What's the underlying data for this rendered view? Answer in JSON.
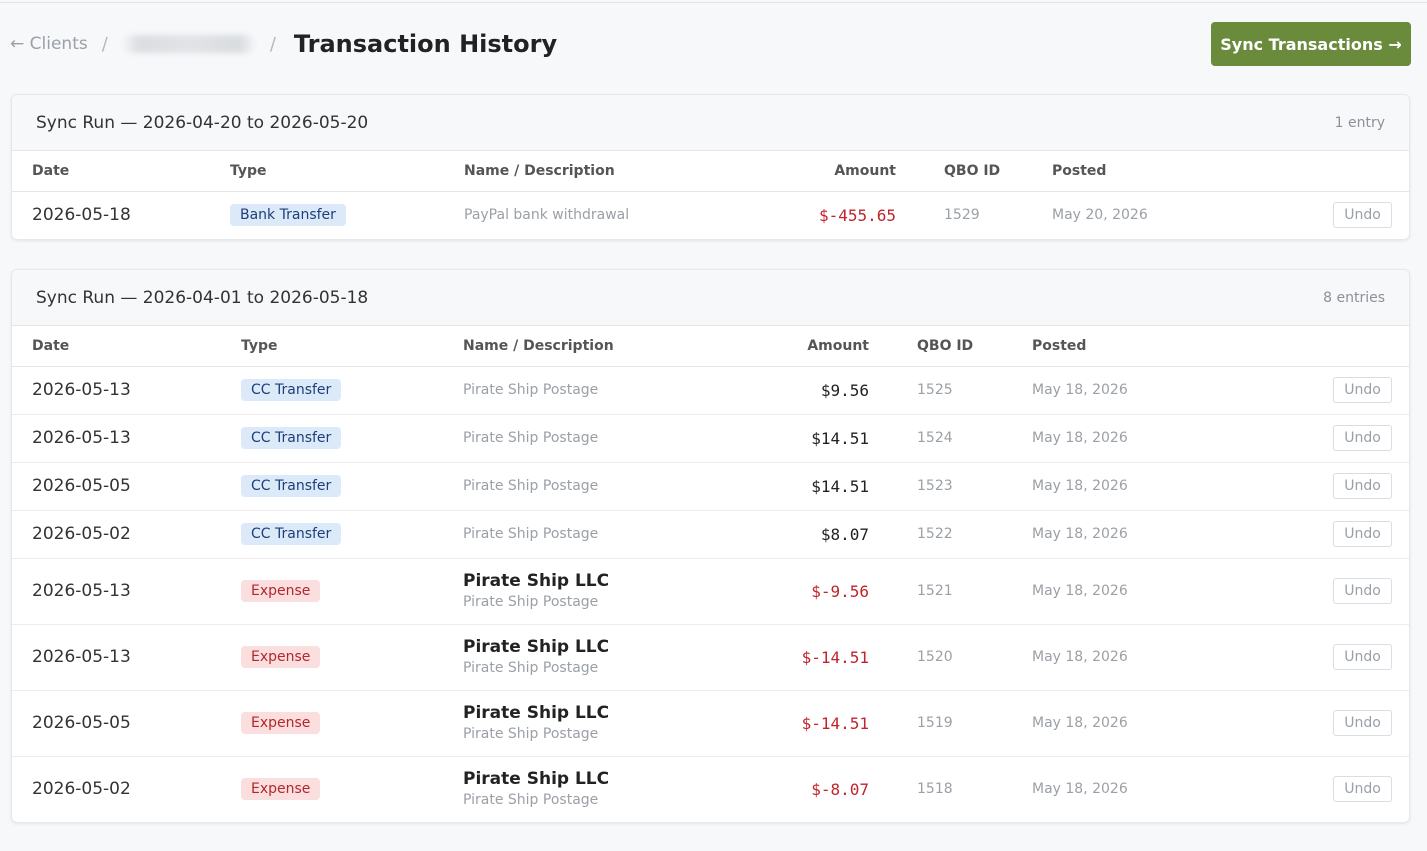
{
  "header": {
    "back_label": "← Clients",
    "separator": "/",
    "title": "Transaction History",
    "sync_button": "Sync Transactions →"
  },
  "columns": {
    "date": "Date",
    "type": "Type",
    "name": "Name / Description",
    "amount": "Amount",
    "qbo": "QBO ID",
    "posted": "Posted"
  },
  "undo_label": "Undo",
  "colors": {
    "accent": "#6a8a3c",
    "negative": "#c0242c",
    "transfer_badge": "#dce9f8",
    "expense_badge": "#fbdede"
  },
  "runs": [
    {
      "title": "Sync Run — 2026-04-20 to 2026-05-20",
      "count": "1 entry",
      "rows": [
        {
          "date": "2026-05-18",
          "type": "Bank Transfer",
          "kind": "transfer",
          "name": "",
          "desc": "PayPal bank withdrawal",
          "amount": "$-455.65",
          "negative": true,
          "qbo": "1529",
          "posted": "May 20, 2026"
        }
      ]
    },
    {
      "title": "Sync Run — 2026-04-01 to 2026-05-18",
      "count": "8 entries",
      "rows": [
        {
          "date": "2026-05-13",
          "type": "CC Transfer",
          "kind": "transfer",
          "name": "",
          "desc": "Pirate Ship Postage",
          "amount": "$9.56",
          "negative": false,
          "qbo": "1525",
          "posted": "May 18, 2026"
        },
        {
          "date": "2026-05-13",
          "type": "CC Transfer",
          "kind": "transfer",
          "name": "",
          "desc": "Pirate Ship Postage",
          "amount": "$14.51",
          "negative": false,
          "qbo": "1524",
          "posted": "May 18, 2026"
        },
        {
          "date": "2026-05-05",
          "type": "CC Transfer",
          "kind": "transfer",
          "name": "",
          "desc": "Pirate Ship Postage",
          "amount": "$14.51",
          "negative": false,
          "qbo": "1523",
          "posted": "May 18, 2026"
        },
        {
          "date": "2026-05-02",
          "type": "CC Transfer",
          "kind": "transfer",
          "name": "",
          "desc": "Pirate Ship Postage",
          "amount": "$8.07",
          "negative": false,
          "qbo": "1522",
          "posted": "May 18, 2026"
        },
        {
          "date": "2026-05-13",
          "type": "Expense",
          "kind": "expense",
          "name": "Pirate Ship LLC",
          "desc": "Pirate Ship Postage",
          "amount": "$-9.56",
          "negative": true,
          "qbo": "1521",
          "posted": "May 18, 2026"
        },
        {
          "date": "2026-05-13",
          "type": "Expense",
          "kind": "expense",
          "name": "Pirate Ship LLC",
          "desc": "Pirate Ship Postage",
          "amount": "$-14.51",
          "negative": true,
          "qbo": "1520",
          "posted": "May 18, 2026"
        },
        {
          "date": "2026-05-05",
          "type": "Expense",
          "kind": "expense",
          "name": "Pirate Ship LLC",
          "desc": "Pirate Ship Postage",
          "amount": "$-14.51",
          "negative": true,
          "qbo": "1519",
          "posted": "May 18, 2026"
        },
        {
          "date": "2026-05-02",
          "type": "Expense",
          "kind": "expense",
          "name": "Pirate Ship LLC",
          "desc": "Pirate Ship Postage",
          "amount": "$-8.07",
          "negative": true,
          "qbo": "1518",
          "posted": "May 18, 2026"
        }
      ]
    }
  ]
}
